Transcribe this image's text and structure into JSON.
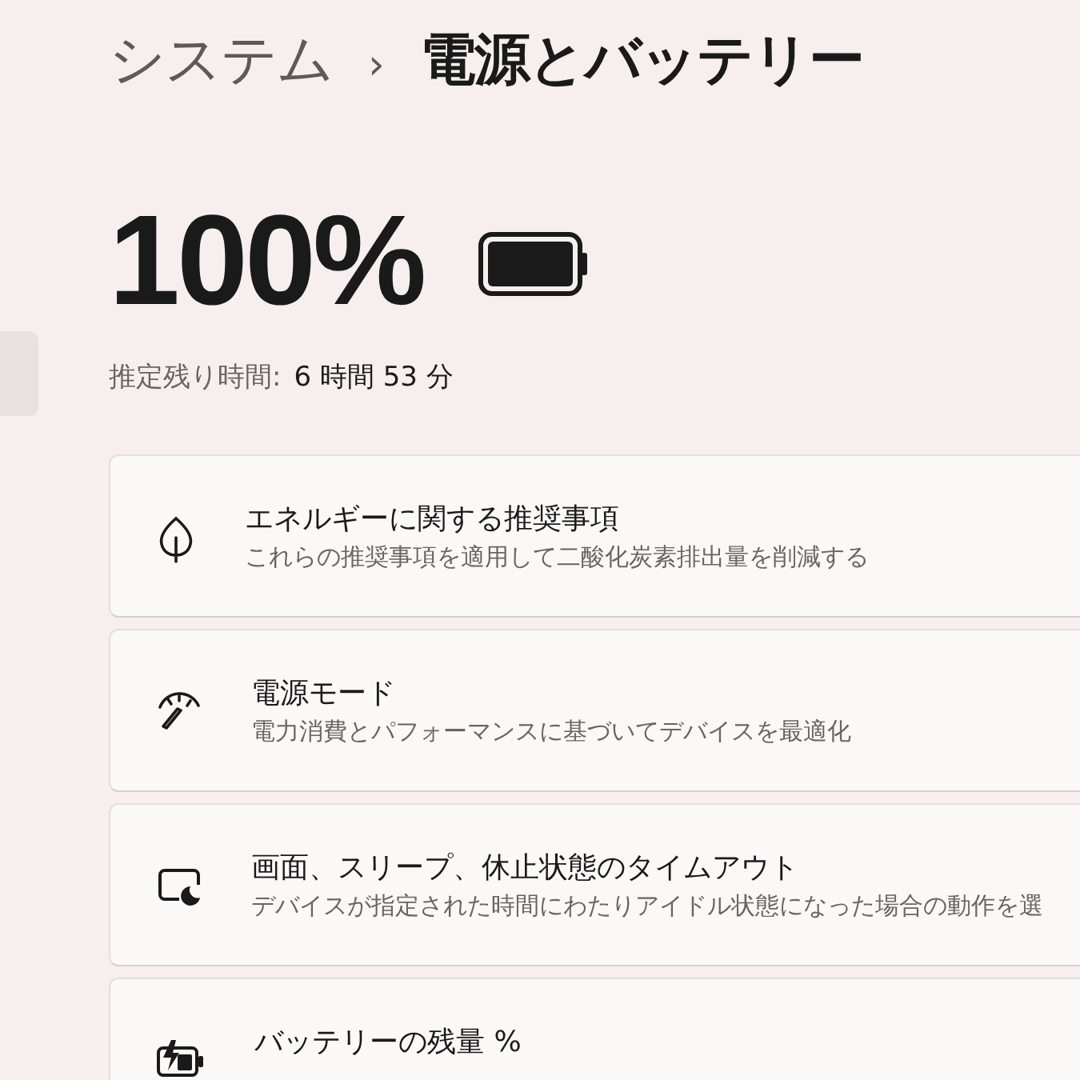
{
  "breadcrumb": {
    "parent": "システム",
    "separator": "›",
    "current": "電源とバッテリー"
  },
  "battery": {
    "percent": "100%",
    "level": 1,
    "estimate_label": "推定残り時間:",
    "estimate_value": "6 時間 53 分"
  },
  "settings": [
    {
      "kind": "leaf",
      "title": "エネルギーに関する推奨事項",
      "subtitle": "これらの推奨事項を適用して二酸化炭素排出量を削減する"
    },
    {
      "kind": "gauge",
      "title": "電源モード",
      "subtitle": "電力消費とパフォーマンスに基づいてデバイスを最適化"
    },
    {
      "kind": "screen-sleep",
      "title": "画面、スリープ、休止状態のタイムアウト",
      "subtitle": "デバイスが指定された時間にわたりアイドル状態になった場合の動作を選"
    },
    {
      "kind": "battery-saver",
      "title": "バッテリーの残量 %"
    }
  ]
}
